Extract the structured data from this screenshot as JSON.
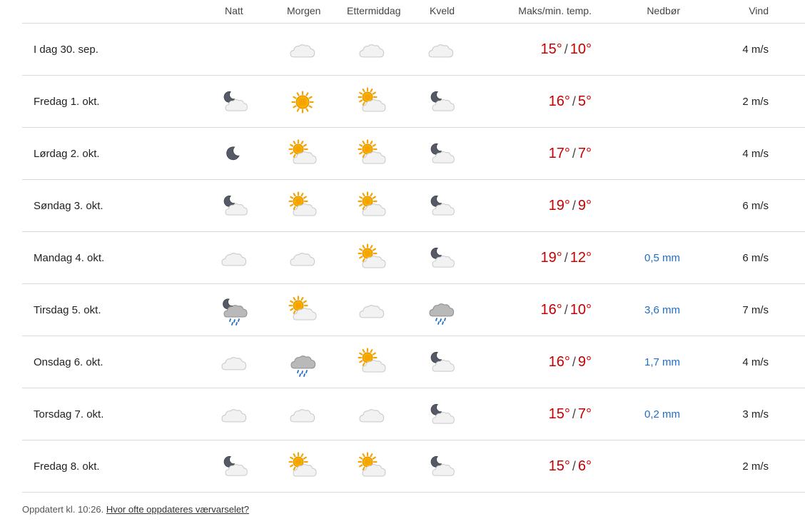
{
  "header": {
    "col_natt": "Natt",
    "col_morgen": "Morgen",
    "col_ettermiddag": "Ettermiddag",
    "col_kveld": "Kveld",
    "col_temp": "Maks/min. temp.",
    "col_nedbor": "Nedbør",
    "col_vind": "Vind"
  },
  "colors": {
    "temp": "#c60000",
    "precipitation": "#1f6fc4",
    "divider": "#d9d9d9"
  },
  "rows": [
    {
      "day": "I dag 30. sep.",
      "icons": [
        "none",
        "cloud-icon",
        "cloud-icon",
        "cloud-icon"
      ],
      "max": "15°",
      "min": "10°",
      "precip": "",
      "wind": "4 m/s"
    },
    {
      "day": "Fredag 1. okt.",
      "icons": [
        "moon-cloud-icon",
        "sun-icon",
        "sun-cloud-icon",
        "moon-cloud-icon"
      ],
      "max": "16°",
      "min": "5°",
      "precip": "",
      "wind": "2 m/s"
    },
    {
      "day": "Lørdag 2. okt.",
      "icons": [
        "moon-icon",
        "sun-cloud-icon",
        "sun-cloud-icon",
        "moon-cloud-icon"
      ],
      "max": "17°",
      "min": "7°",
      "precip": "",
      "wind": "4 m/s"
    },
    {
      "day": "Søndag 3. okt.",
      "icons": [
        "moon-cloud-icon",
        "sun-cloud-icon",
        "sun-cloud-icon",
        "moon-cloud-icon"
      ],
      "max": "19°",
      "min": "9°",
      "precip": "",
      "wind": "6 m/s"
    },
    {
      "day": "Mandag 4. okt.",
      "icons": [
        "cloud-icon",
        "cloud-icon",
        "sun-cloud-icon",
        "moon-cloud-icon"
      ],
      "max": "19°",
      "min": "12°",
      "precip": "0,5 mm",
      "wind": "6 m/s"
    },
    {
      "day": "Tirsdag 5. okt.",
      "icons": [
        "moon-rain-cloud-icon",
        "sun-cloud-icon",
        "cloud-icon",
        "rain-cloud-icon"
      ],
      "max": "16°",
      "min": "10°",
      "precip": "3,6 mm",
      "wind": "7 m/s"
    },
    {
      "day": "Onsdag 6. okt.",
      "icons": [
        "cloud-icon",
        "rain-cloud-icon",
        "sun-cloud-icon",
        "moon-cloud-icon"
      ],
      "max": "16°",
      "min": "9°",
      "precip": "1,7 mm",
      "wind": "4 m/s"
    },
    {
      "day": "Torsdag 7. okt.",
      "icons": [
        "cloud-icon",
        "cloud-icon",
        "cloud-icon",
        "moon-cloud-icon"
      ],
      "max": "15°",
      "min": "7°",
      "precip": "0,2 mm",
      "wind": "3 m/s"
    },
    {
      "day": "Fredag 8. okt.",
      "icons": [
        "moon-cloud-icon",
        "sun-cloud-icon",
        "sun-cloud-icon",
        "moon-cloud-icon"
      ],
      "max": "15°",
      "min": "6°",
      "precip": "",
      "wind": "2 m/s"
    }
  ],
  "footer": {
    "updated": "Oppdatert kl. 10:26.",
    "link": "Hvor ofte oppdateres værvarselet?"
  }
}
